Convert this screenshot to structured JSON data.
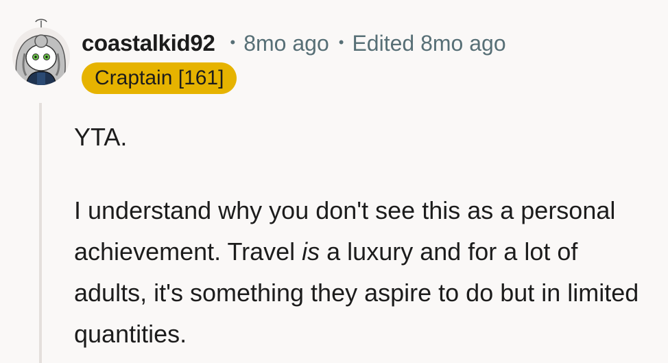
{
  "comment": {
    "username": "coastalkid92",
    "time": "8mo ago",
    "edited": "Edited 8mo ago",
    "flair": "Craptain [161]",
    "body": {
      "paragraph1": "YTA.",
      "paragraph2_before": "I understand why you don't see this as a personal achievement. Travel ",
      "paragraph2_emphasis": "is",
      "paragraph2_after": " a luxury and for a lot of adults, it's something they aspire to do but in limited quantities."
    }
  },
  "colors": {
    "background": "#faf8f7",
    "flair_background": "#e6b300",
    "meta_text": "#576f76",
    "thread_line": "#e4dfdc"
  }
}
